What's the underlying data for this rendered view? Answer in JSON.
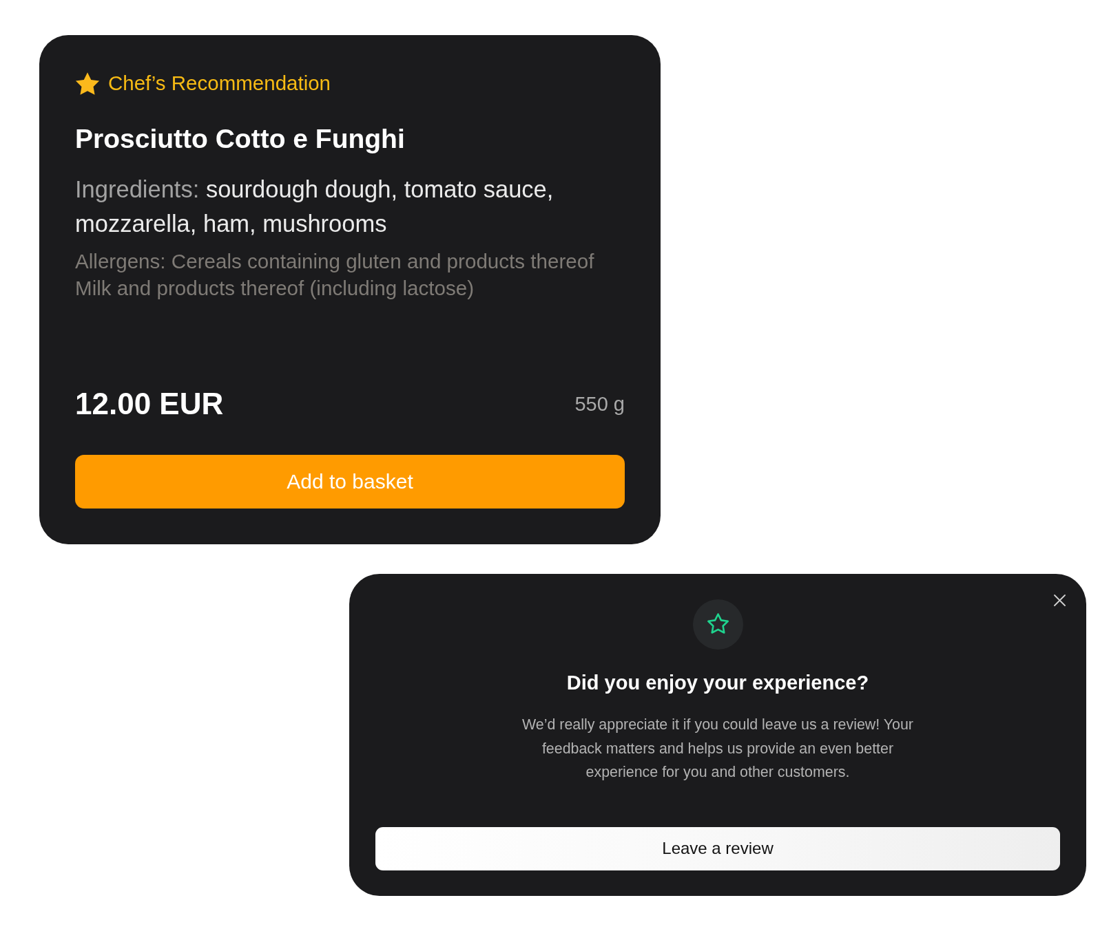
{
  "menu_item": {
    "badge": "Chef’s Recommendation",
    "name": "Prosciutto Cotto e Funghi",
    "ingredients_label": "Ingredients:",
    "ingredients": "sourdough dough, tomato sauce, mozzarella, ham, mushrooms",
    "allergens": [
      "Allergens: Cereals containing gluten and products thereof",
      "Milk and products thereof (including lactose)"
    ],
    "price": "12.00 EUR",
    "weight": "550 g",
    "button": "Add to basket"
  },
  "review_prompt": {
    "title": "Did you enjoy your experience?",
    "message": "We’d really appreciate it if you could leave us a review! Your feedback matters and helps us provide an even better experience for you and other customers.",
    "button": "Leave a review"
  }
}
